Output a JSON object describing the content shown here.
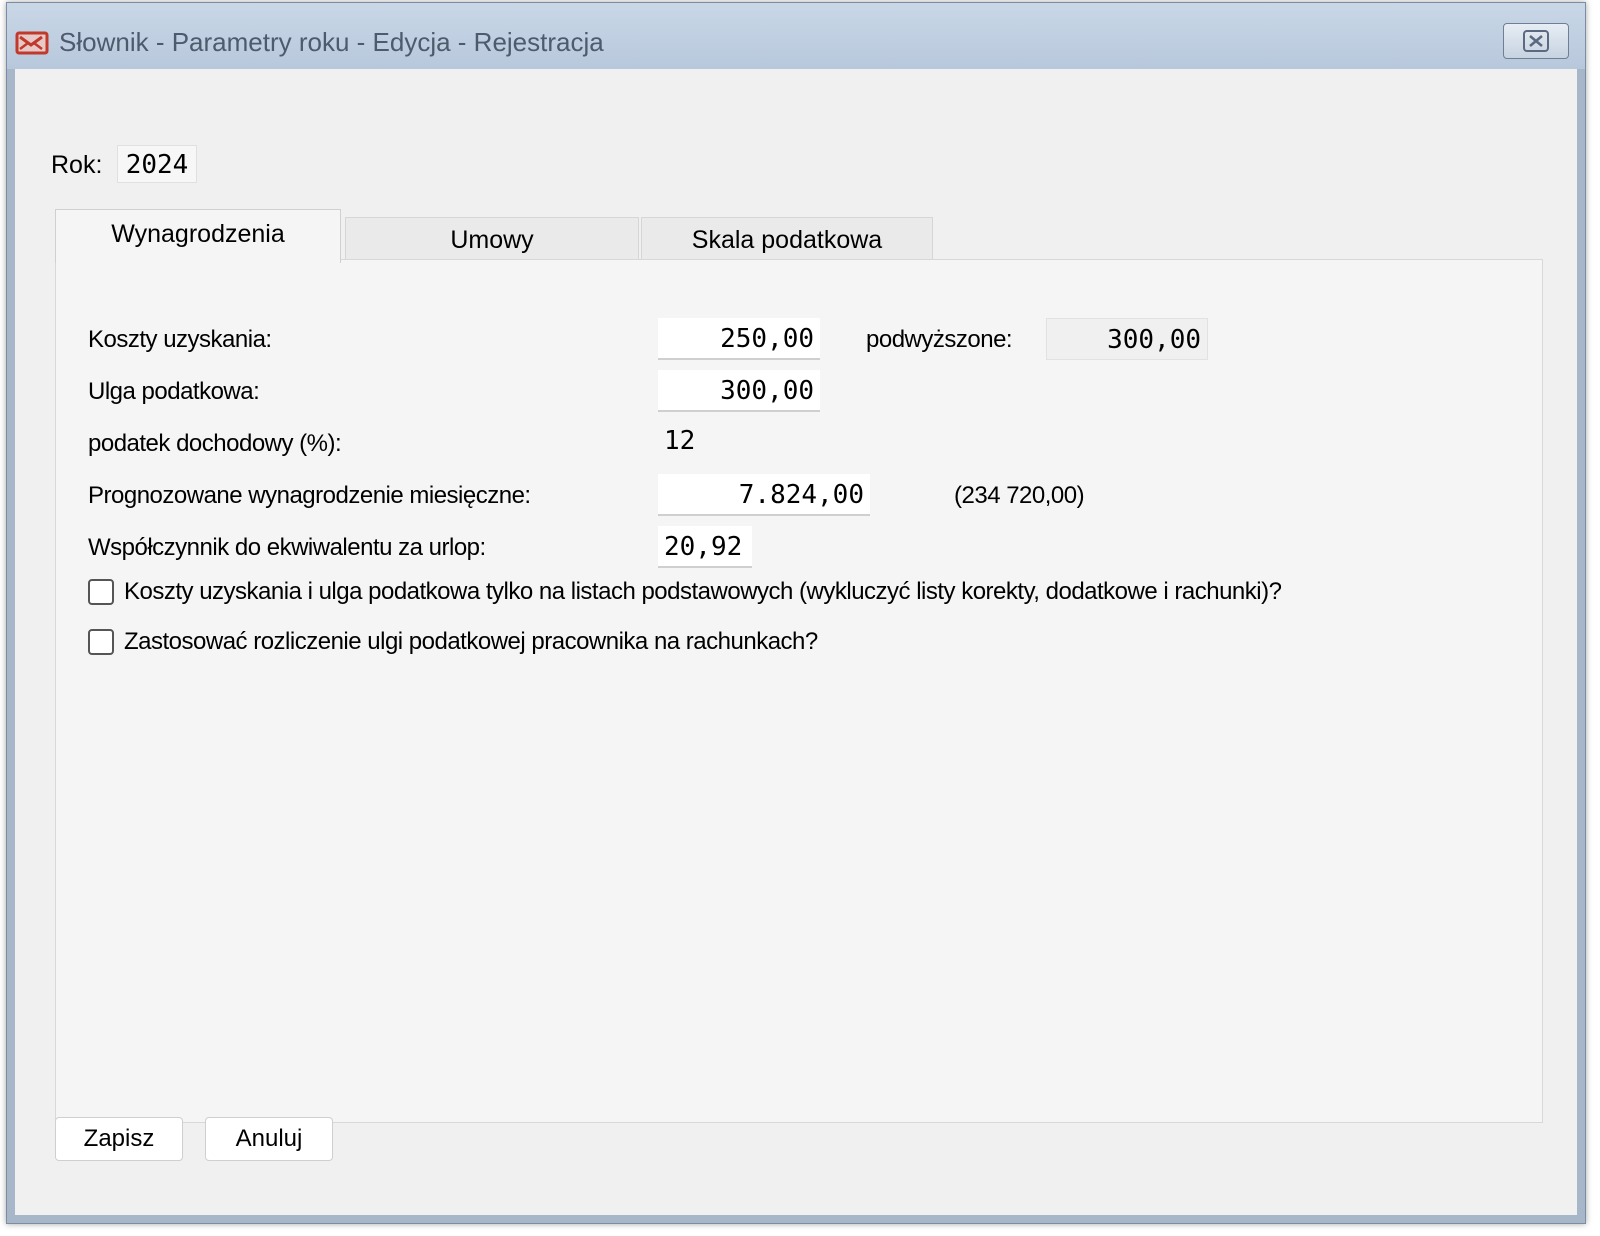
{
  "window": {
    "title": "Słownik - Parametry roku - Edycja - Rejestracja",
    "close_glyph": "✕"
  },
  "year": {
    "label": "Rok:",
    "value": "2024"
  },
  "tabs": [
    {
      "label": "Wynagrodzenia",
      "active": true
    },
    {
      "label": "Umowy",
      "active": false
    },
    {
      "label": "Skala podatkowa",
      "active": false
    }
  ],
  "fields": {
    "koszty_label": "Koszty uzyskania:",
    "koszty_value": "250,00",
    "podwyzszone_label": "podwyższone:",
    "podwyzszone_value": "300,00",
    "ulga_label": "Ulga podatkowa:",
    "ulga_value": "300,00",
    "podatek_label": "podatek dochodowy (%):",
    "podatek_value": "12",
    "prognoza_label": "Prognozowane wynagrodzenie miesięczne:",
    "prognoza_value": "7.824,00",
    "prognoza_yearly": "(234 720,00)",
    "wspolczynnik_label": "Współczynnik do ekwiwalentu za urlop:",
    "wspolczynnik_value": "20,92"
  },
  "checkboxes": {
    "koszty_only_label": "Koszty uzyskania i ulga podatkowa tylko na listach podstawowych (wykluczyć listy korekty, dodatkowe i rachunki)?",
    "zastosowac_label": "Zastosować rozliczenie ulgi podatkowej pracownika na rachunkach?"
  },
  "buttons": {
    "save_label": "Zapisz",
    "cancel_label": "Anuluj"
  },
  "colors": {
    "accent": "#c0392b",
    "titlebar": "#c9d7e7",
    "client": "#f0f0f0"
  }
}
